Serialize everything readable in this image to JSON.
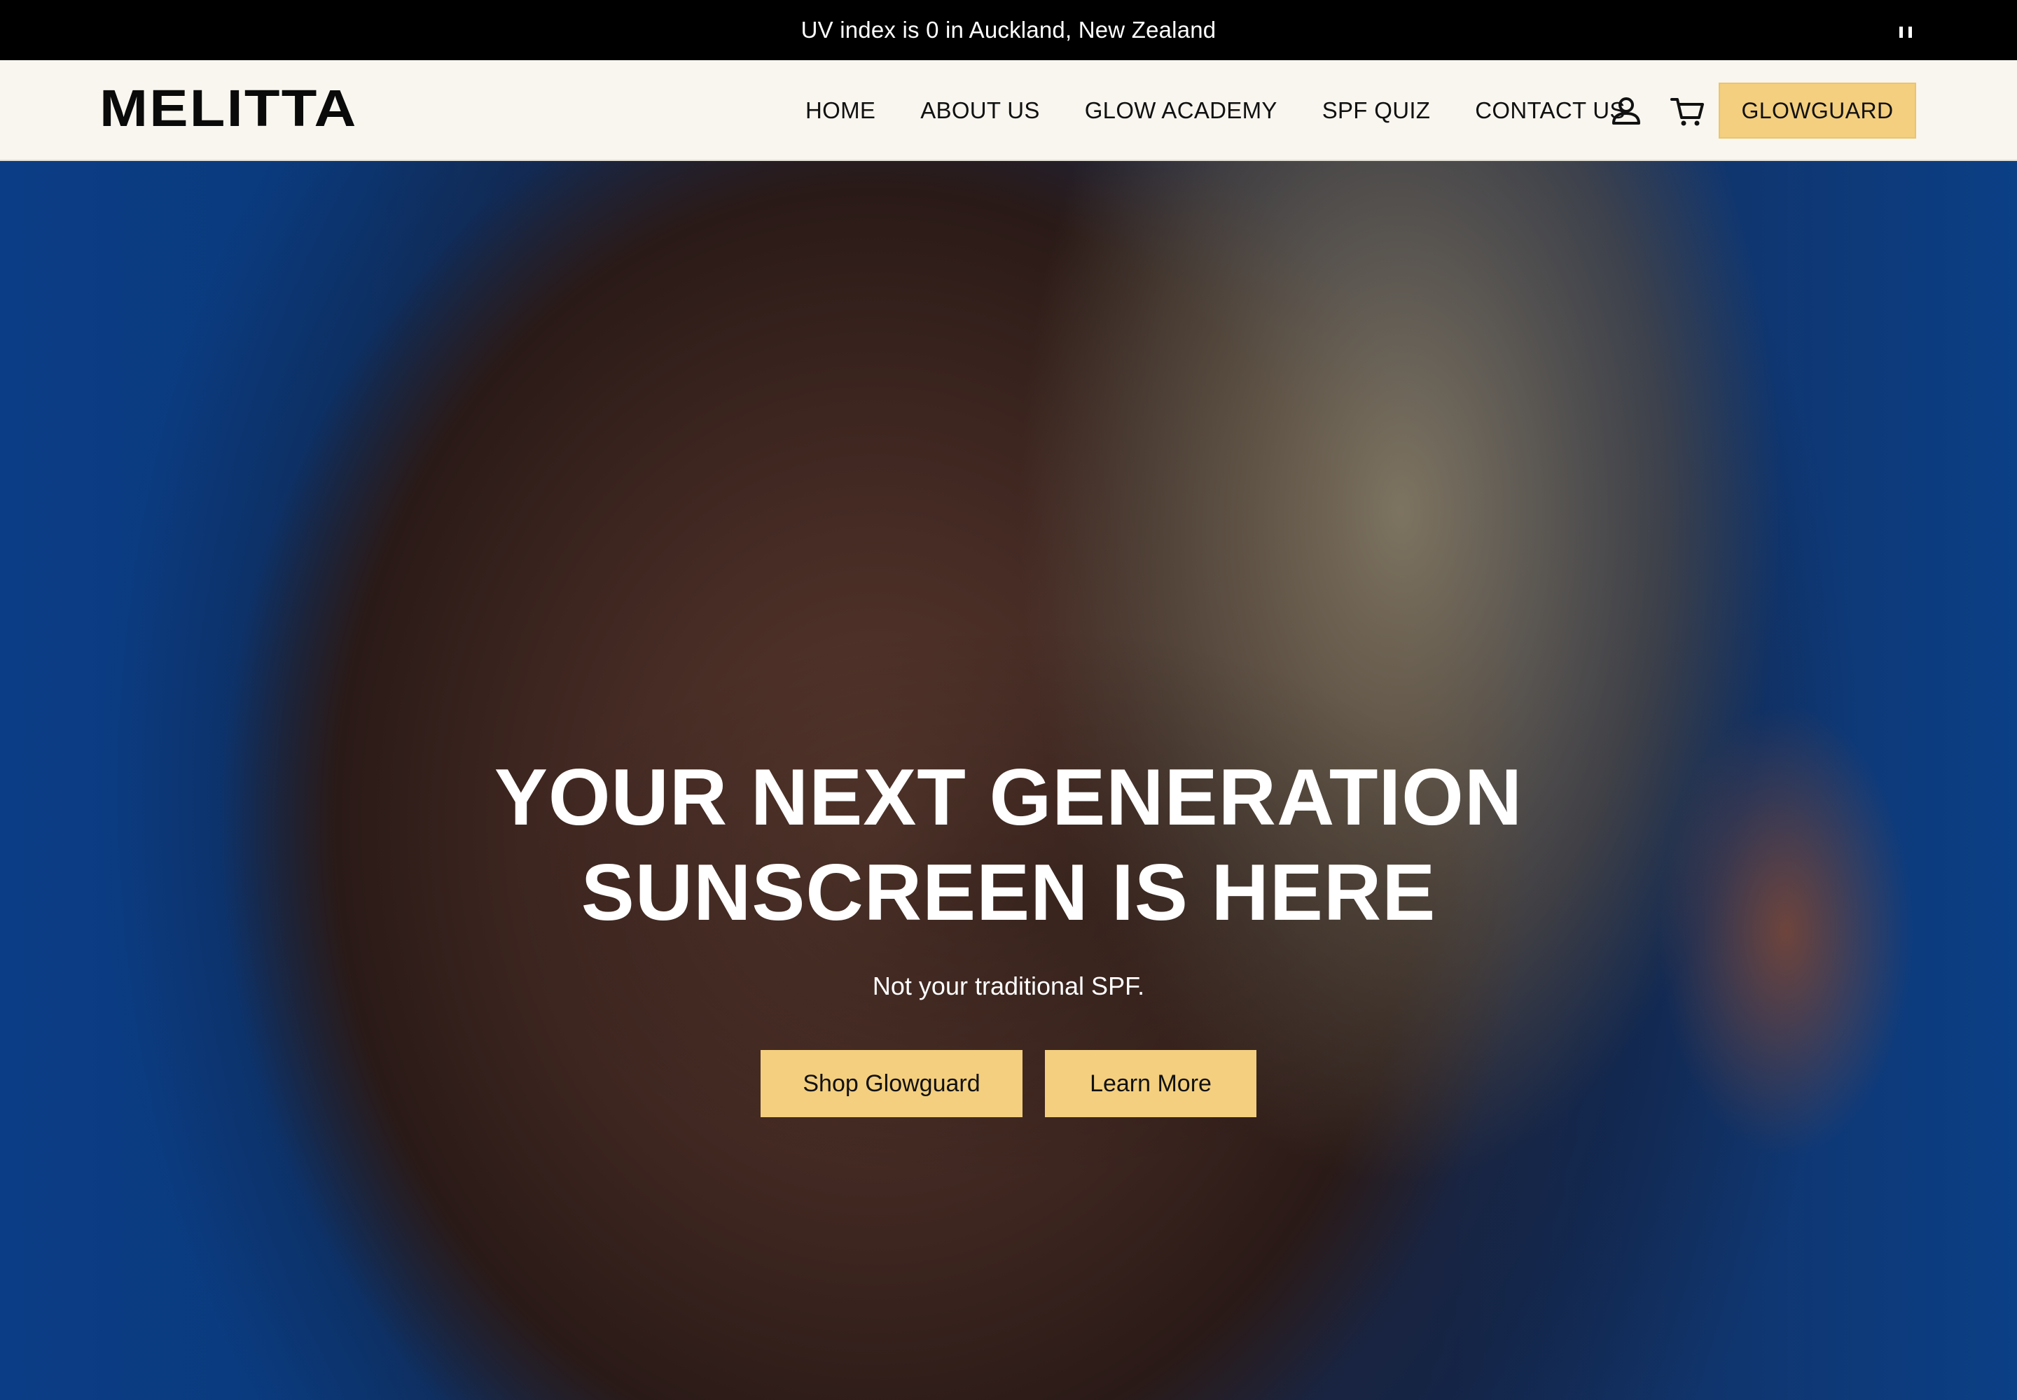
{
  "announcement": {
    "text": "UV index is 0 in Auckland, New Zealand",
    "control_icon": "pause-icon"
  },
  "header": {
    "logo": "MELITTA",
    "nav": [
      {
        "label": "HOME"
      },
      {
        "label": "ABOUT US"
      },
      {
        "label": "GLOW ACADEMY"
      },
      {
        "label": "SPF QUIZ"
      },
      {
        "label": "CONTACT US"
      }
    ],
    "icons": [
      "account-icon",
      "cart-icon"
    ],
    "cta_label": "GLOWGUARD"
  },
  "hero": {
    "title_line1": "YOUR NEXT GENERATION",
    "title_line2": "SUNSCREEN IS HERE",
    "subtitle": "Not your traditional SPF.",
    "primary_button": "Shop Glowguard",
    "secondary_button": "Learn More"
  },
  "colors": {
    "accent": "#f3cf7f",
    "header_bg": "#f8f6ef",
    "announcement_bg": "#000000"
  }
}
